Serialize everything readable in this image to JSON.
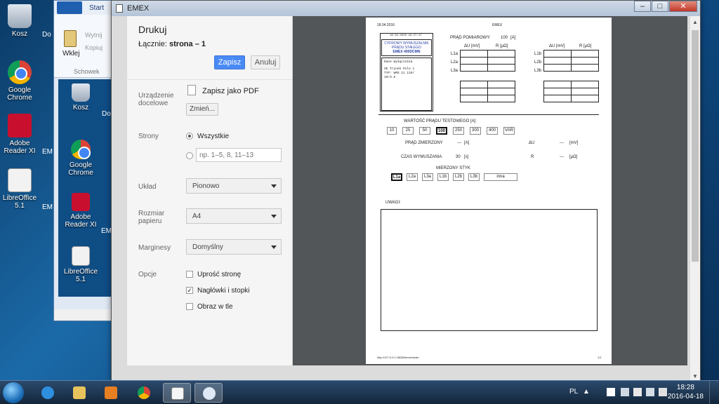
{
  "desktop": {
    "icons": [
      {
        "label": "Kosz",
        "icon": "recycle-bin-icon"
      },
      {
        "label": "Google Chrome",
        "icon": "chrome-icon"
      },
      {
        "label": "Adobe Reader XI",
        "icon": "adobe-reader-icon"
      },
      {
        "label": "LibreOffice 5.1",
        "icon": "libreoffice-icon"
      }
    ]
  },
  "explorer": {
    "tab_start": "Start",
    "paste": "Wklej",
    "cut": "Wytnij",
    "copy": "Kopiuj",
    "group": "Schowek",
    "inner_icons": [
      "Kosz",
      "Google Chrome",
      "Adobe Reader XI",
      "LibreOffice 5.1"
    ],
    "cut_labels": [
      "Do",
      "Do",
      "EM",
      "EM",
      "EM"
    ]
  },
  "window": {
    "title": "EMEX",
    "minimize": "–",
    "maximize": "□",
    "close": "✕"
  },
  "print": {
    "title": "Drukuj",
    "total_prefix": "Łącznie: ",
    "total_value": "strona – 1",
    "save_label": "Zapisz",
    "cancel_label": "Anuluj",
    "destination_label": "Urządzenie docelowe",
    "destination_value": "Zapisz jako PDF",
    "change_label": "Zmień...",
    "pages_label": "Strony",
    "pages_all": "Wszystkie",
    "pages_placeholder": "np. 1–5, 8, 11–13",
    "layout_label": "Układ",
    "layout_value": "Pionowo",
    "paper_label": "Rozmiar papieru",
    "paper_value": "A4",
    "margins_label": "Marginesy",
    "margins_value": "Domyślny",
    "options_label": "Opcje",
    "opt_simplify": "Uprość stronę",
    "opt_headers": "Nagłówki i stopki",
    "opt_bg": "Obraz w tle",
    "opt_headers_checked": true
  },
  "paper": {
    "date": "18.04.2016",
    "header_title": "EMEX",
    "timestamp": "18.04.2016 18:27:47",
    "device_line1": "CYFROWY WYMUSZALNIK",
    "device_line2": "PRĄDU STAŁEGO",
    "device_line3": "EMEX 400DCMN",
    "data_label": "Dane Wyłącznika",
    "data_line1": "SE Trynek Pole 1",
    "data_line2": "TYP: WMS 11 110/",
    "data_line3": "10/3.5",
    "measure_label": "PRĄD POMIAROWY:",
    "measure_value": "100",
    "measure_unit": "[A]",
    "col_du": "ΔU [mV]",
    "col_r": "R [μΩ]",
    "rows_a": [
      "L1a",
      "L2a",
      "L3a"
    ],
    "rows_b": [
      "L1b",
      "L2b",
      "L3b"
    ],
    "test_current_label": "WARTOŚĆ PRĄDU TESTOWEGO [A]",
    "test_values": [
      "10",
      "25",
      "50",
      "100",
      "250",
      "300",
      "400",
      "VAR"
    ],
    "test_selected": "100",
    "measured_label": "PRĄD ZMIERZONY",
    "measured_value": "---",
    "measured_unit": "[A]",
    "du_label": "ΔU",
    "du_value": "---",
    "du_unit": "[mV]",
    "time_label": "CZAS WYMUSZANIA",
    "time_value": "30",
    "time_unit": "[s]",
    "r_label": "R",
    "r_value": "---",
    "r_unit": "[μΩ]",
    "contact_label": "MIERZONY STYK",
    "contacts": [
      "L1a",
      "L2a",
      "L3a",
      "L1b",
      "L2b",
      "L3b"
    ],
    "contact_selected": "L1a",
    "contact_other": "inna",
    "remarks_label": "UWAGI:",
    "footer_url": "http://127.0.0.1:18080/emex/main",
    "footer_page": "1/1"
  },
  "taskbar": {
    "lang": "PL",
    "time": "18:28",
    "date": "2016-04-18"
  }
}
